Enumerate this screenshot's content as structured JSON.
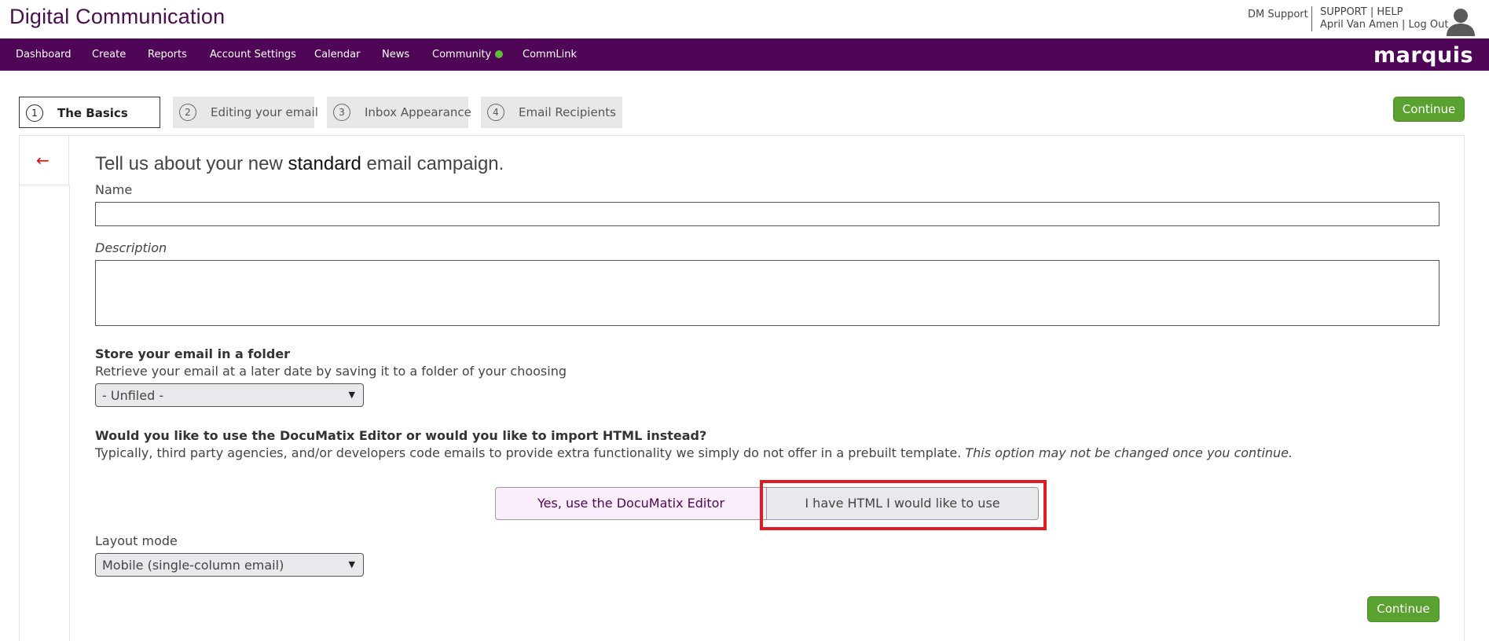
{
  "header": {
    "brand": "Digital Communication",
    "dm_support": "DM Support",
    "support": "SUPPORT",
    "help": "HELP",
    "user": "April Van Amen",
    "logout": "Log Out",
    "sep": "|"
  },
  "nav": {
    "items": [
      "Dashboard",
      "Create",
      "Reports",
      "Account Settings",
      "Calendar",
      "News",
      "Community",
      "CommLink"
    ],
    "logo": "marquis"
  },
  "steps": [
    {
      "num": "1",
      "label": "The Basics"
    },
    {
      "num": "2",
      "label": "Editing your email"
    },
    {
      "num": "3",
      "label": "Inbox Appearance"
    },
    {
      "num": "4",
      "label": "Email Recipients"
    }
  ],
  "continue_label": "Continue",
  "form": {
    "heading_pre": "Tell us about your new ",
    "heading_strong": "standard",
    "heading_post": " email campaign.",
    "name_label": "Name",
    "name_value": "",
    "description_label": "Description",
    "description_value": "",
    "folder_title": "Store your email in a folder",
    "folder_desc": "Retrieve your email at a later date by saving it to a folder of your choosing",
    "folder_selected": "- Unfiled -",
    "editor_question": "Would you like to use the DocuMatix Editor or would you like to import HTML instead?",
    "editor_desc": "Typically, third party agencies, and/or developers code emails to provide extra functionality we simply do not offer in a prebuilt template. ",
    "editor_note": "This option may not be changed once you continue.",
    "choice_editor": "Yes, use the DocuMatix Editor",
    "choice_html": "I have HTML I would like to use",
    "layout_label": "Layout mode",
    "layout_selected": "Mobile (single-column email)"
  },
  "colors": {
    "brand_purple": "#4f0656",
    "continue_green": "#59a22f",
    "highlight_red": "#e01b22",
    "back_arrow_red": "#d0121b"
  },
  "icons": {
    "back": "arrow-left-icon",
    "user": "user-avatar-icon",
    "caret": "caret-down-icon",
    "community_status": "status-dot-icon"
  }
}
